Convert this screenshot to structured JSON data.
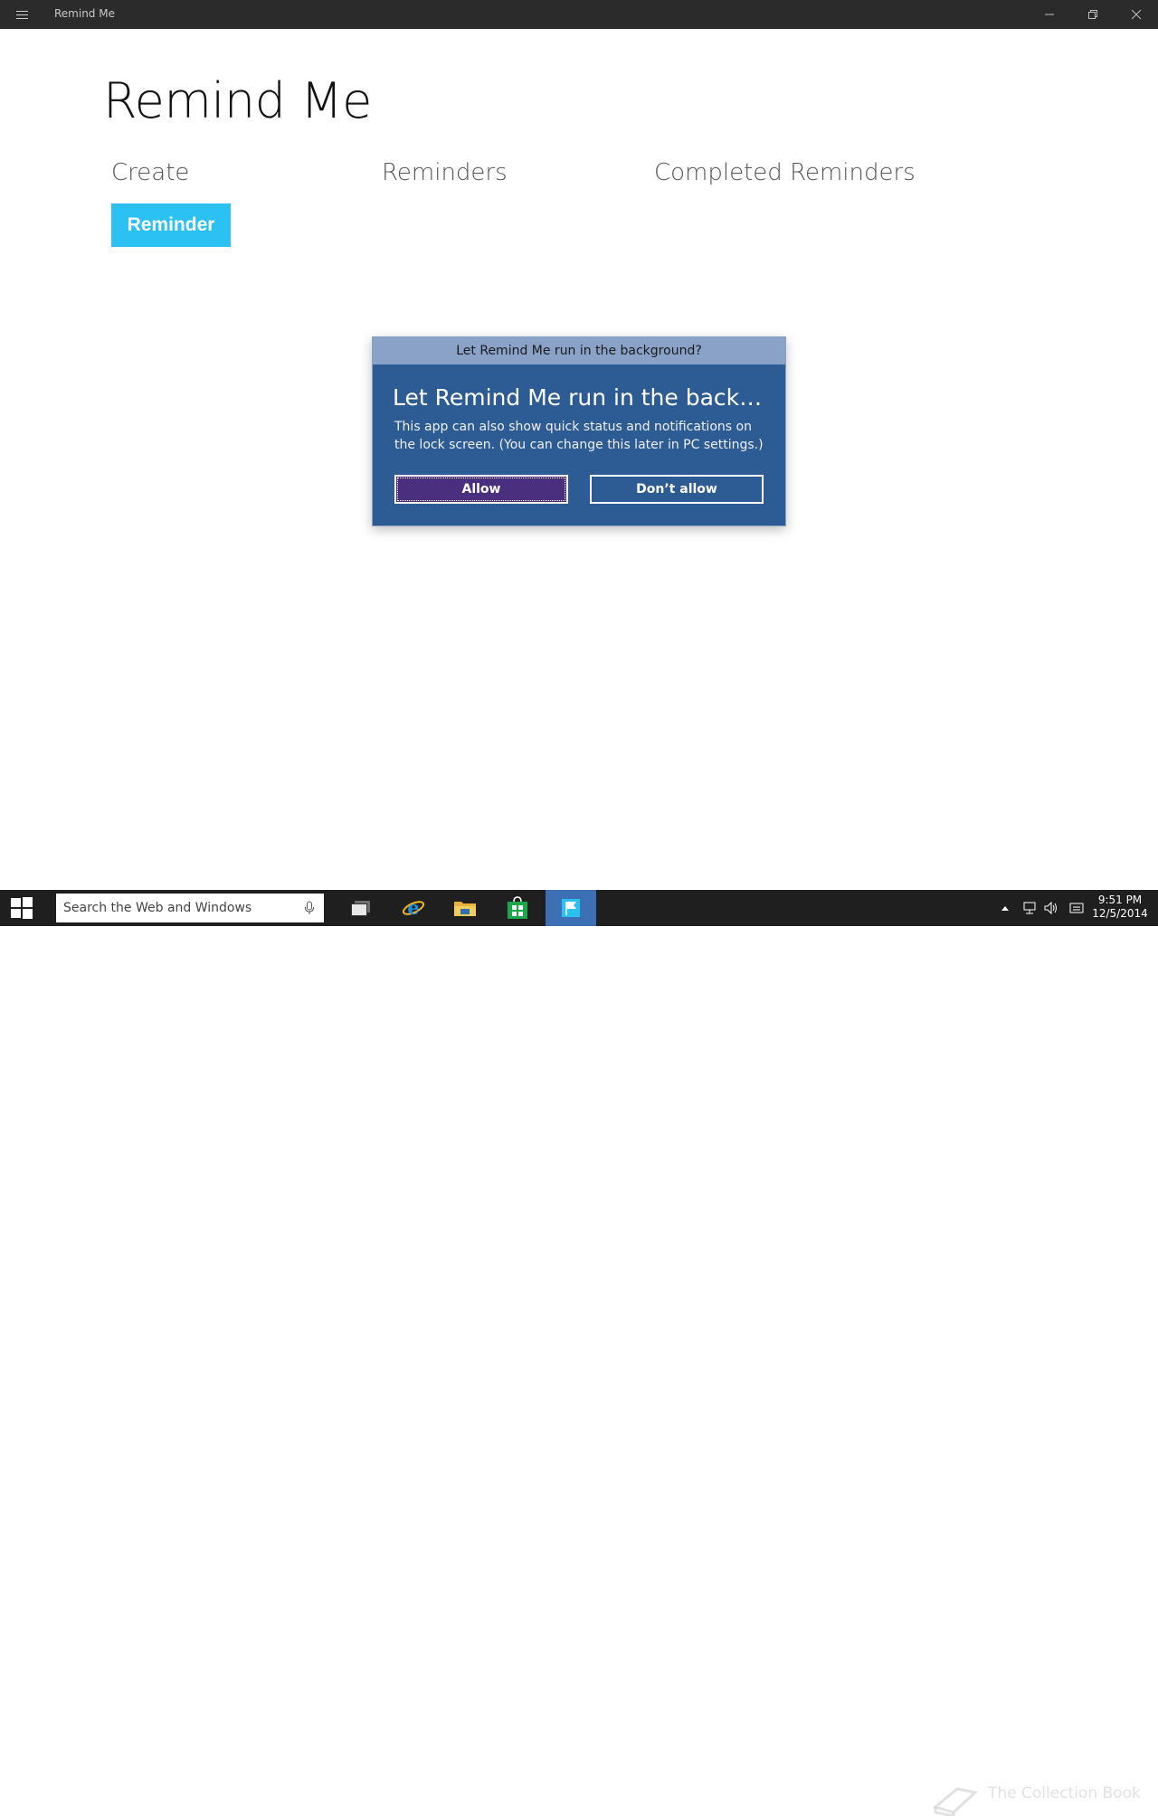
{
  "window": {
    "title": "Remind Me",
    "controls": {
      "minimize_icon": "minimize-icon",
      "maximize_icon": "restore-icon",
      "close_icon": "close-icon"
    }
  },
  "main": {
    "app_title": "Remind Me",
    "sections": {
      "create": "Create",
      "reminders": "Reminders",
      "completed": "Completed Reminders"
    },
    "reminder_button_label": "Reminder",
    "accent_color": "#2bc1f2"
  },
  "dialog": {
    "caption": "Let Remind Me run in the background?",
    "title": "Let Remind Me run in the background?",
    "body": "This app can also show quick status and notifications on the lock screen. (You can change this later in PC settings.)",
    "allow_label": "Allow",
    "deny_label": "Don’t allow",
    "background_color": "#2d5b94",
    "allow_color": "#4a2f7e"
  },
  "taskbar": {
    "search_placeholder": "Search the Web and Windows",
    "watermark": "The Collection Book",
    "clock_time": "9:51 PM",
    "clock_date": "12/5/2014",
    "active_color": "#3c6fb4"
  }
}
